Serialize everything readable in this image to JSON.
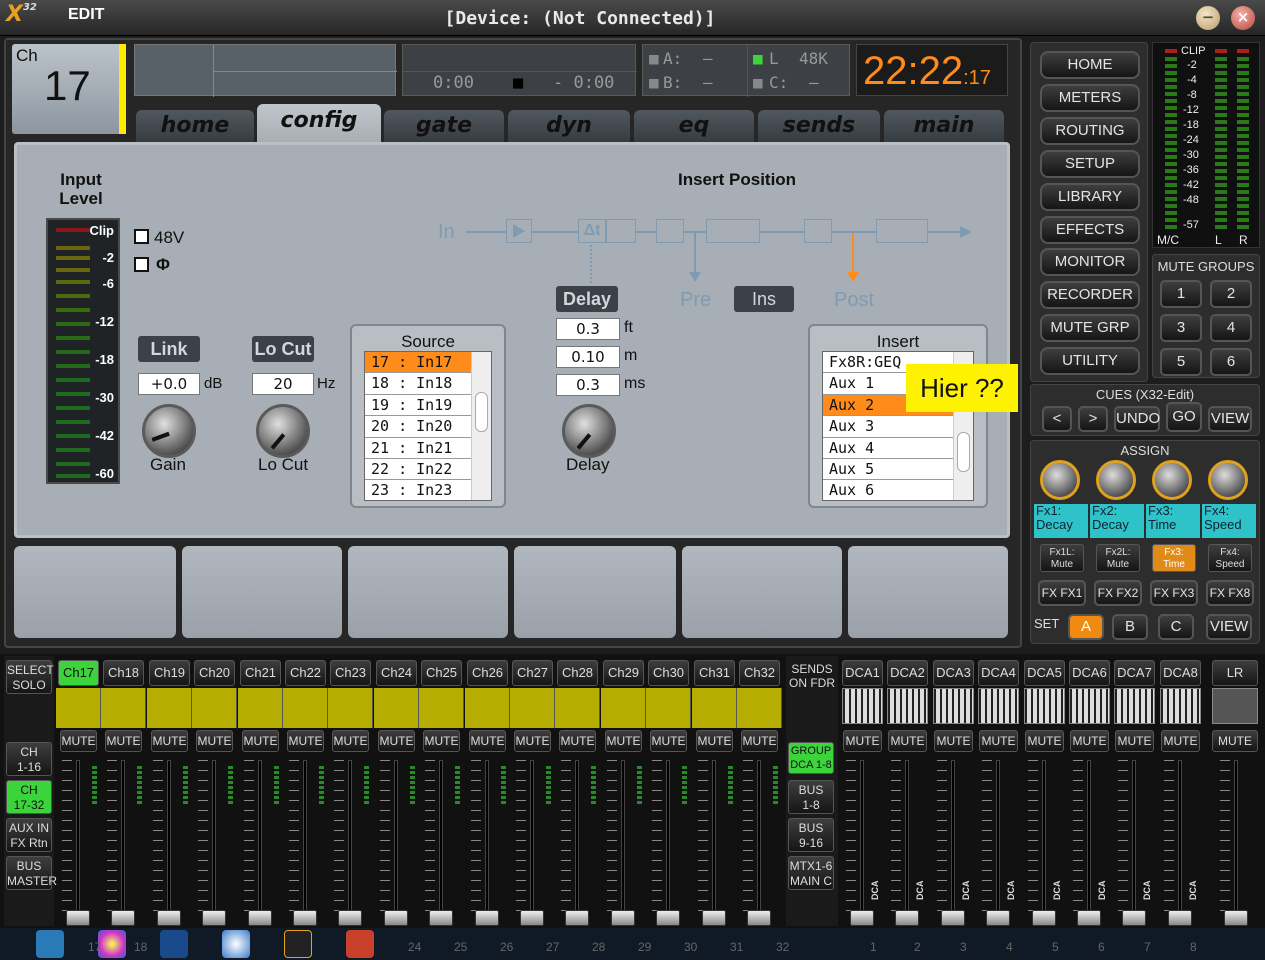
{
  "app": {
    "logo_main": "X",
    "logo_sup": "32",
    "logo_edit": "EDIT",
    "window_title": "[Device: (Not Connected)]",
    "minimize": "−",
    "close": "×"
  },
  "channel": {
    "label": "Ch",
    "number": "17"
  },
  "transport": {
    "time_elapsed": "0:00",
    "stop_symbol": "■",
    "time_remaining": "- 0:00"
  },
  "status": {
    "a_label": "A:",
    "a_val": "–",
    "b_label": "B:",
    "b_val": "–",
    "l_label": "L",
    "l_val": "48K",
    "c_label": "C:",
    "c_val": "–"
  },
  "clock": {
    "main": "22:22",
    "sec": ":17"
  },
  "tabs": [
    "home",
    "config",
    "gate",
    "dyn",
    "eq",
    "sends",
    "main"
  ],
  "config": {
    "input_level_title_1": "Input",
    "input_level_title_2": "Level",
    "meter_labels": [
      "Clip",
      "-2",
      "-6",
      "-12",
      "-18",
      "-30",
      "-42",
      "-60"
    ],
    "phantom": "48V",
    "phase": "Φ",
    "link": "Link",
    "gain_value": "+0.0",
    "gain_unit": "dB",
    "gain_label": "Gain",
    "locut_title": "Lo Cut",
    "locut_value": "20",
    "locut_unit": "Hz",
    "locut_label": "Lo Cut",
    "source_title": "Source",
    "source_items": [
      "17 : In17",
      "18 : In18",
      "19 : In19",
      "20 : In20",
      "21 : In21",
      "22 : In22",
      "23 : In23"
    ],
    "insert_position_title": "Insert Position",
    "sig_in": "In",
    "sig_delay": "Δt",
    "sig_pre": "Pre",
    "sig_ins": "Ins",
    "sig_post": "Post",
    "delay_title": "Delay",
    "delay_ft": "0.3",
    "unit_ft": "ft",
    "delay_m": "0.10",
    "unit_m": "m",
    "delay_ms": "0.3",
    "unit_ms": "ms",
    "delay_label": "Delay",
    "insert_title": "Insert",
    "insert_items": [
      "Fx8R:GEQ",
      "Aux 1",
      "Aux 2",
      "Aux 3",
      "Aux 4",
      "Aux 5",
      "Aux 6"
    ],
    "annotation": "Hier ??"
  },
  "nav": [
    "HOME",
    "METERS",
    "ROUTING",
    "SETUP",
    "LIBRARY",
    "EFFECTS",
    "MONITOR",
    "RECORDER",
    "MUTE GRP",
    "UTILITY"
  ],
  "clip_meter": {
    "clip": "CLIP",
    "labels": [
      "-2",
      "-4",
      "-8",
      "-12",
      "-18",
      "-24",
      "-30",
      "-36",
      "-42",
      "-48",
      "-57"
    ],
    "mc": "M/C",
    "l": "L",
    "r": "R"
  },
  "mute_groups": {
    "title": "MUTE GROUPS",
    "buttons": [
      "1",
      "2",
      "3",
      "4",
      "5",
      "6"
    ]
  },
  "cues": {
    "title": "CUES (X32-Edit)",
    "prev": "<",
    "next": ">",
    "undo": "UNDO",
    "go": "GO",
    "view": "VIEW"
  },
  "assign": {
    "title": "ASSIGN",
    "fx_labels": [
      [
        "Fx1:",
        "Decay"
      ],
      [
        "Fx2:",
        "Decay"
      ],
      [
        "Fx3:",
        "Time"
      ],
      [
        "Fx4:",
        "Speed"
      ]
    ],
    "fx_buttons": [
      [
        "Fx1L:",
        "Mute"
      ],
      [
        "Fx2L:",
        "Mute"
      ],
      [
        "Fx3:",
        "Time"
      ],
      [
        "Fx4:",
        "Speed"
      ]
    ],
    "fx_fx": [
      "FX FX1",
      "FX FX2",
      "FX FX3",
      "FX FX8"
    ],
    "set": "SET",
    "sets": [
      "A",
      "B",
      "C"
    ],
    "view": "VIEW"
  },
  "mixer": {
    "left_buttons": [
      [
        "SELECT",
        "SOLO"
      ],
      [
        "CH",
        "1-16"
      ],
      [
        "CH",
        "17-32"
      ],
      [
        "AUX IN",
        "FX Rtn"
      ],
      [
        "BUS",
        "MASTER"
      ]
    ],
    "channels": [
      "Ch17",
      "Ch18",
      "Ch19",
      "Ch20",
      "Ch21",
      "Ch22",
      "Ch23",
      "Ch24",
      "Ch25",
      "Ch26",
      "Ch27",
      "Ch28",
      "Ch29",
      "Ch30",
      "Ch31",
      "Ch32"
    ],
    "mute": "MUTE",
    "sends_title": [
      "SENDS",
      "ON FDR"
    ],
    "sends_buttons": [
      [
        "GROUP",
        "DCA 1-8"
      ],
      [
        "BUS",
        "1-8"
      ],
      [
        "BUS",
        "9-16"
      ],
      [
        "MTX1-6",
        "MAIN C"
      ]
    ],
    "dcas": [
      "DCA1",
      "DCA2",
      "DCA3",
      "DCA4",
      "DCA5",
      "DCA6",
      "DCA7",
      "DCA8"
    ],
    "lr": "LR",
    "dca_tag": "DCA"
  },
  "taskbar": {
    "numbers": [
      "17",
      "18",
      "24",
      "25",
      "26",
      "27",
      "28",
      "29",
      "30",
      "31",
      "32",
      "1",
      "2",
      "3",
      "4",
      "5",
      "6",
      "7",
      "8"
    ]
  },
  "colors": {
    "accent_orange": "#ff8c1a",
    "yellow": "#ffeb00",
    "green": "#3bd43b",
    "cyan": "#2ec3c8",
    "panel": "#a7aeb5"
  }
}
